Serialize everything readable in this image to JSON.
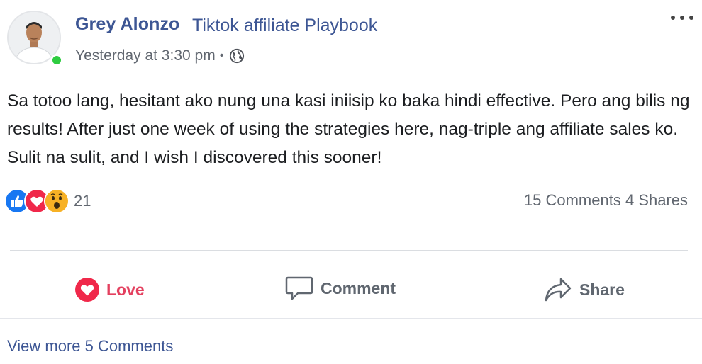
{
  "post": {
    "author": "Grey Alonzo",
    "group": "Tiktok affiliate Playbook",
    "timestamp": "Yesterday at 3:30 pm",
    "separator": "•",
    "privacy_icon": "globe-icon",
    "body": "Sa totoo lang, hesitant ako nung una kasi iniisip ko baka hindi effective. Pero ang bilis ng results! After just one week of using the strategies here, nag-triple ang affiliate sales ko. Sulit na sulit, and I wish I discovered this sooner!",
    "reactions": {
      "icons": [
        "like-icon",
        "love-icon",
        "wow-icon"
      ],
      "count": "21"
    },
    "stats": "15 Comments 4 Shares",
    "actions": {
      "love": "Love",
      "comment": "Comment",
      "share": "Share"
    },
    "view_more": "View more 5 Comments"
  },
  "colors": {
    "link": "#3d5694",
    "love": "#e4405f",
    "like": "#1877f2",
    "wow": "#f7b125",
    "online": "#2ecc40",
    "muted": "#616770"
  }
}
